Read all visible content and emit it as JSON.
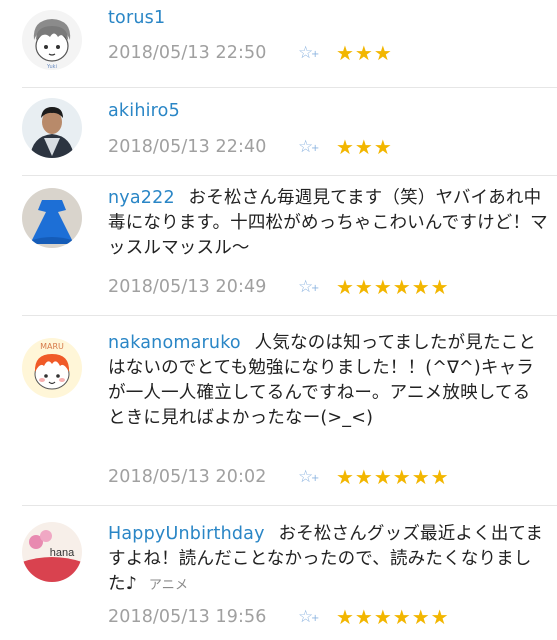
{
  "comments": [
    {
      "user": "torus1",
      "text": "",
      "timestamp": "2018/05/13 22:50",
      "stars": "★★★",
      "avatar_text": "Yuki"
    },
    {
      "user": "akihiro5",
      "text": "",
      "timestamp": "2018/05/13 22:40",
      "stars": "★★★"
    },
    {
      "user": "nya222",
      "text": "おそ松さん毎週見てます（笑）ヤバイあれ中毒になります。十四松がめっちゃこわいんですけど！マッスルマッスル〜",
      "timestamp": "2018/05/13 20:49",
      "stars": "★★★★★★"
    },
    {
      "user": "nakanomaruko",
      "text": "人気なのは知ってましたが見たことはないのでとても勉強になりました！！(^∇^)キャラが一人一人確立してるんですねー。アニメ放映してるときに見ればよかったなー(>_<)",
      "timestamp": "2018/05/13 20:02",
      "stars": "★★★★★★",
      "avatar_text": "MARU"
    },
    {
      "user": "HappyUnbirthday",
      "text": "おそ松さんグッズ最近よく出てますよね！読んだことなかったので、読みたくなりました♪",
      "tag": "アニメ",
      "timestamp": "2018/05/13 19:56",
      "stars": "★★★★★★",
      "avatar_text": "hana"
    }
  ],
  "icons": {
    "add_star": "star-add-icon"
  },
  "colors": {
    "username": "#2a86c6",
    "star": "#f2b600",
    "add_star": "#8db4e0",
    "timestamp": "#a0a0a0"
  }
}
